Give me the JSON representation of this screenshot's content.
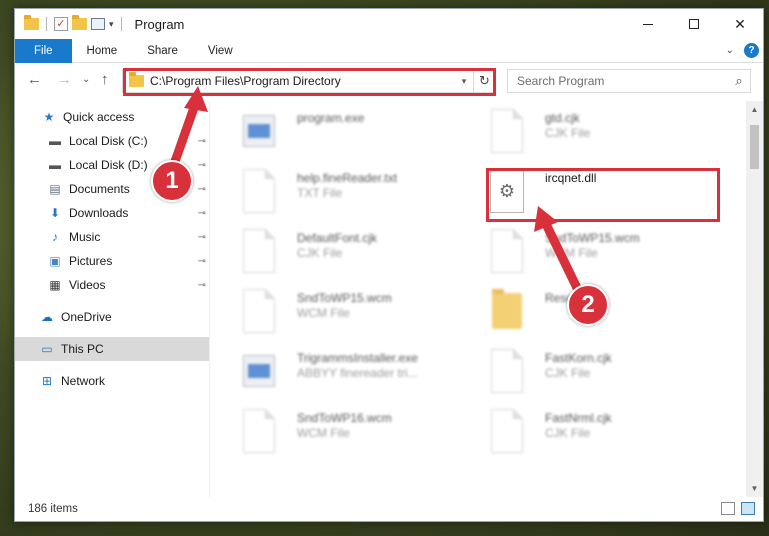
{
  "titlebar": {
    "title": "Program",
    "quick_access_icons": [
      "folder-icon",
      "properties-check-icon",
      "new-folder-icon",
      "customize-caret-icon"
    ],
    "minimize": "minimize-icon",
    "maximize": "maximize-icon",
    "close_glyph": "✕"
  },
  "ribbon": {
    "tabs": [
      {
        "label": "File"
      },
      {
        "label": "Home"
      },
      {
        "label": "Share"
      },
      {
        "label": "View"
      }
    ],
    "expand_glyph": "⌄",
    "help_glyph": "?"
  },
  "navbar": {
    "back_glyph": "←",
    "forward_glyph": "→",
    "recent_glyph": "⌄",
    "up_glyph": "↑",
    "address": "C:\\Program Files\\Program Directory",
    "refresh_glyph": "↻",
    "search_placeholder": "Search Program"
  },
  "sidebar": {
    "items": [
      {
        "label": "Quick access",
        "icon": "star-icon",
        "glyph": "★",
        "color": "#2a79c8",
        "pinned": false
      },
      {
        "label": "Local Disk (C:)",
        "icon": "drive-icon",
        "glyph": "▬",
        "color": "#555555",
        "pinned": true
      },
      {
        "label": "Local Disk (D:)",
        "icon": "drive-icon",
        "glyph": "▬",
        "color": "#555555",
        "pinned": true
      },
      {
        "label": "Documents",
        "icon": "documents-icon",
        "glyph": "▤",
        "color": "#5a6e82",
        "pinned": true
      },
      {
        "label": "Downloads",
        "icon": "download-icon",
        "glyph": "⬇",
        "color": "#2a79c8",
        "pinned": true
      },
      {
        "label": "Music",
        "icon": "music-icon",
        "glyph": "♪",
        "color": "#2a79c8",
        "pinned": true
      },
      {
        "label": "Pictures",
        "icon": "pictures-icon",
        "glyph": "▣",
        "color": "#4a86c5",
        "pinned": true
      },
      {
        "label": "Videos",
        "icon": "videos-icon",
        "glyph": "▦",
        "color": "#3b3b3b",
        "pinned": true
      },
      {
        "label": "OneDrive",
        "icon": "cloud-icon",
        "glyph": "☁",
        "color": "#1e6fc4",
        "pinned": false
      },
      {
        "label": "This PC",
        "icon": "computer-icon",
        "glyph": "▭",
        "color": "#2a79c8",
        "pinned": false,
        "selected": true
      },
      {
        "label": "Network",
        "icon": "network-icon",
        "glyph": "⊞",
        "color": "#2a79c8",
        "pinned": false
      }
    ],
    "pin_glyph": "📌"
  },
  "files": [
    {
      "name": "program.exe",
      "type": "",
      "icon": "installer-icon"
    },
    {
      "name": "gtd.cjk",
      "type": "CJK File",
      "icon": "document-icon"
    },
    {
      "name": "help.fineReader.txt",
      "type": "TXT File",
      "icon": "document-icon"
    },
    {
      "name": "ircqnet.dll",
      "type": "",
      "icon": "dll-gear-icon"
    },
    {
      "name": "DefaultFont.cjk",
      "type": "CJK File",
      "icon": "document-icon"
    },
    {
      "name": "SndToWP15.wcm",
      "type": "WCM File",
      "icon": "document-icon"
    },
    {
      "name": "SndToWP15.wcm",
      "type": "WCM File",
      "icon": "document-icon"
    },
    {
      "name": "Resources",
      "type": "",
      "icon": "folder-icon"
    },
    {
      "name": "TrigrammsInstaller.exe",
      "type": "ABBYY finereader tri...",
      "icon": "installer-icon"
    },
    {
      "name": "FastKorn.cjk",
      "type": "CJK File",
      "icon": "document-icon"
    },
    {
      "name": "SndToWP16.wcm",
      "type": "WCM File",
      "icon": "document-icon"
    },
    {
      "name": "FastNrml.cjk",
      "type": "CJK File",
      "icon": "document-icon"
    }
  ],
  "status": {
    "items_count": "186 items"
  },
  "annotations": {
    "badge_1": "1",
    "badge_2": "2",
    "color": "#d8313b"
  }
}
